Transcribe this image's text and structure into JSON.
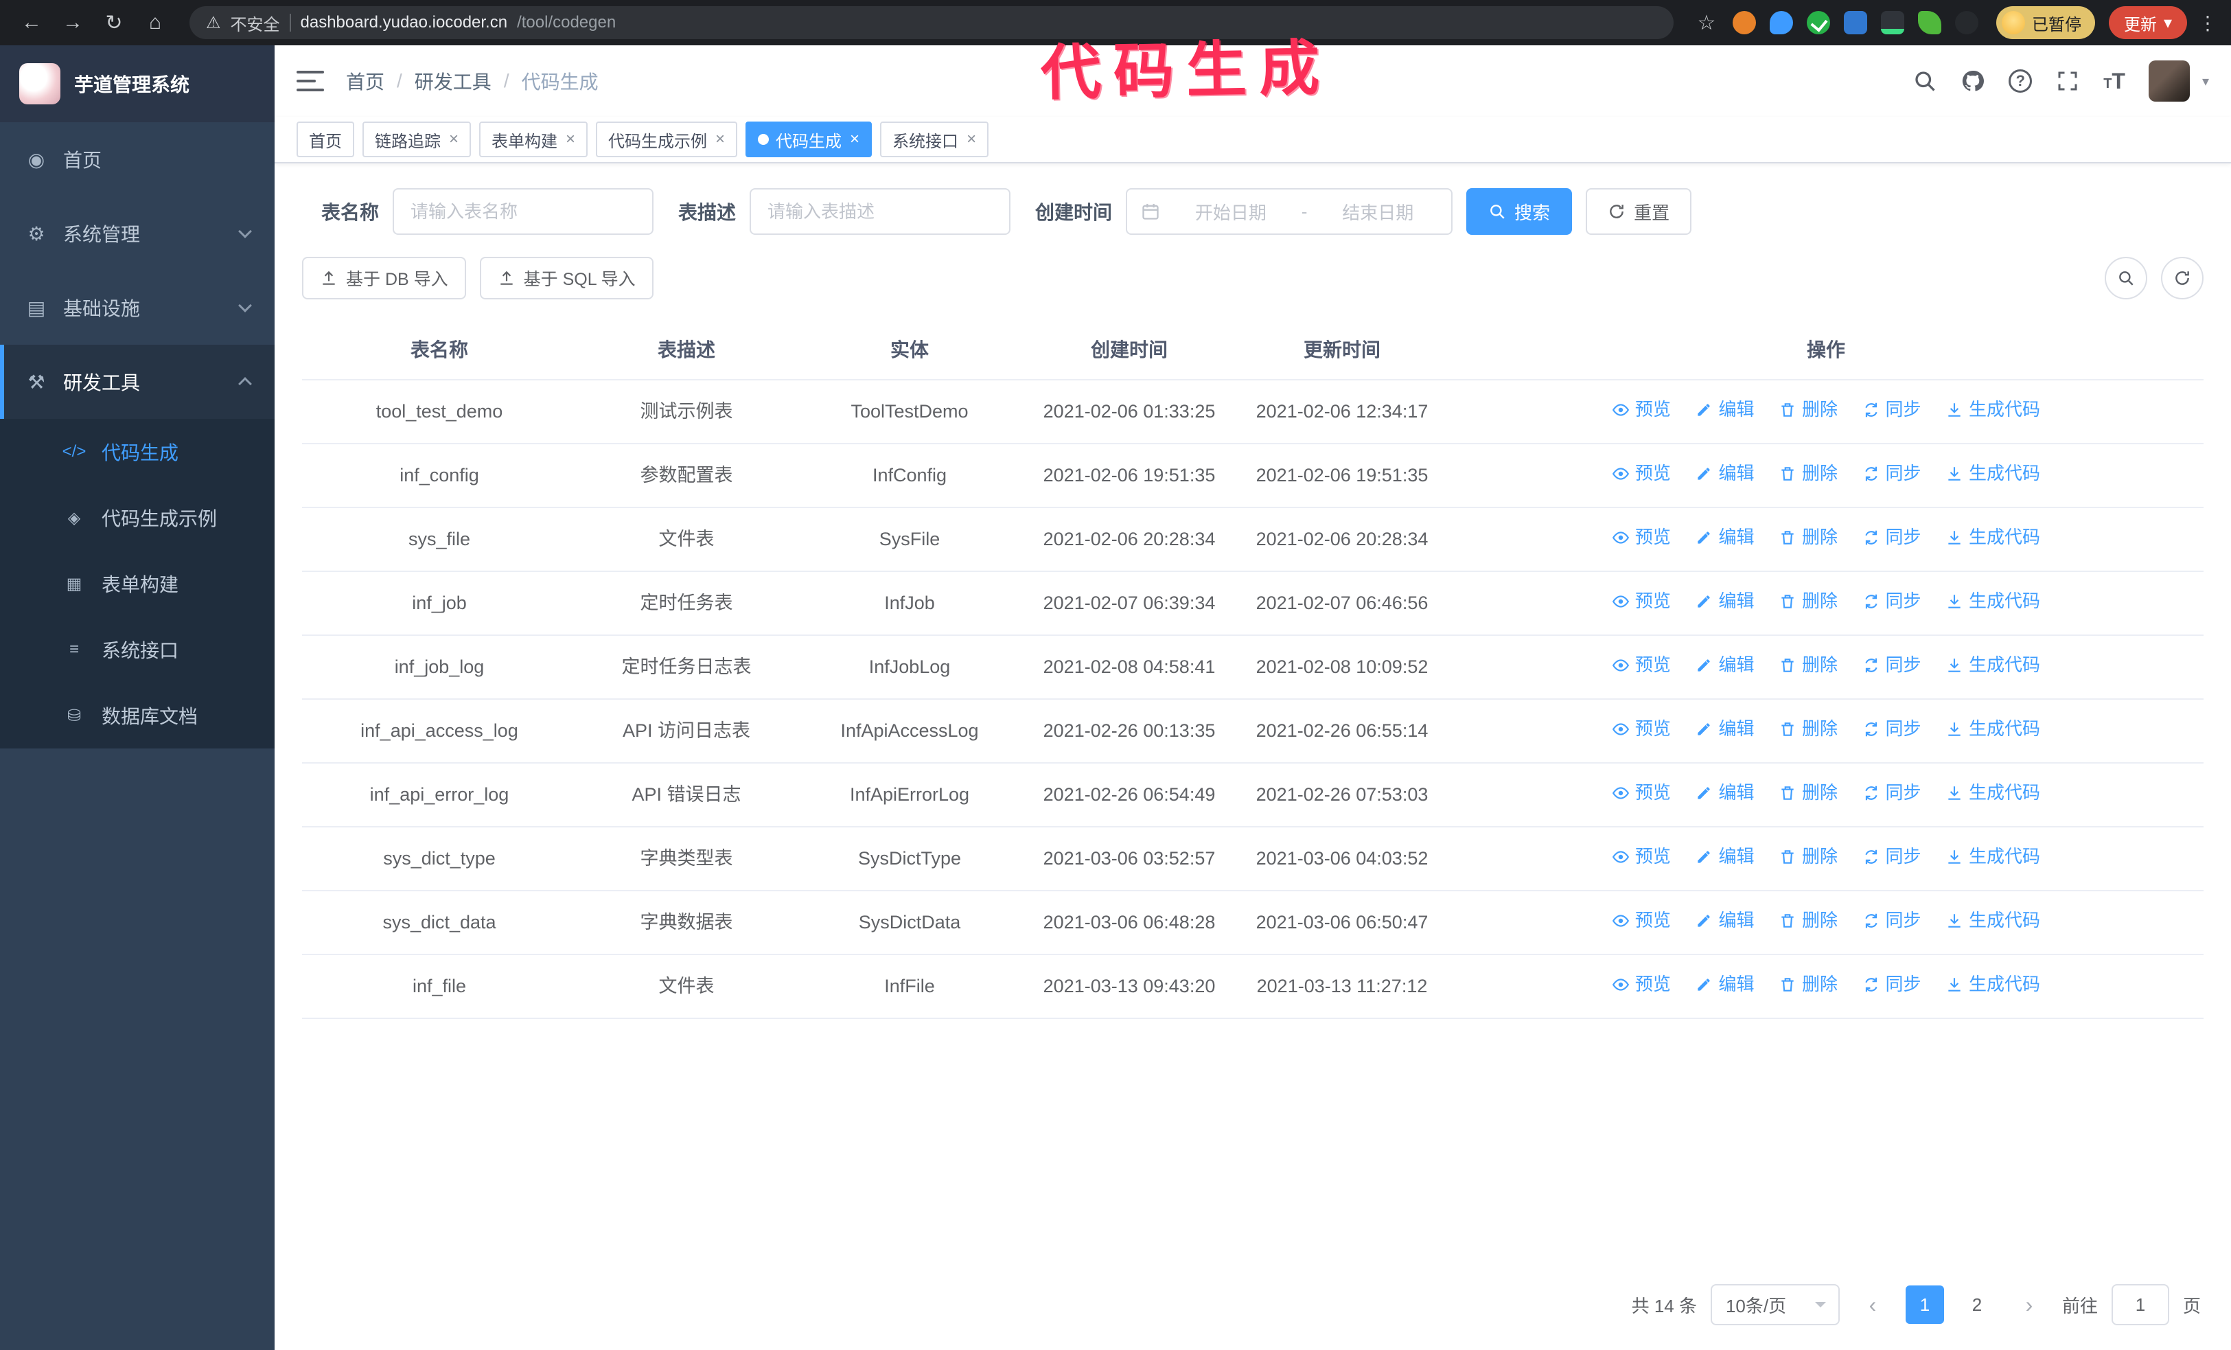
{
  "colors": {
    "accent": "#409eff",
    "sidebar": "#304156",
    "submenu": "#1f2d3d",
    "annotation": "#fb2e57"
  },
  "icons": {
    "back": "←",
    "forward": "→",
    "reload": "↻",
    "home": "⌂",
    "warning": "⚠",
    "star": "☆",
    "kebab": "⋮",
    "close": "×",
    "prev": "‹",
    "next": "›",
    "question": "?",
    "caret_down": "▾",
    "font_size": "T",
    "font_size_small": "T"
  },
  "browser": {
    "security_label": "不安全",
    "url_host": "dashboard.yudao.iocoder.cn",
    "url_path": "/tool/codegen",
    "profile_badge": "已暂停",
    "update_button": "更新"
  },
  "annotation": {
    "text": "代码生成"
  },
  "sidebar": {
    "logo_title": "芋道管理系统",
    "items": [
      {
        "label": "首页",
        "icon": "◉"
      },
      {
        "label": "系统管理",
        "icon": "⚙"
      },
      {
        "label": "基础设施",
        "icon": "▤"
      },
      {
        "label": "研发工具",
        "icon": "⚒"
      }
    ],
    "sub_items": [
      {
        "label": "代码生成",
        "icon": "</>"
      },
      {
        "label": "代码生成示例",
        "icon": "◈"
      },
      {
        "label": "表单构建",
        "icon": "▦"
      },
      {
        "label": "系统接口",
        "icon": "≡"
      },
      {
        "label": "数据库文档",
        "icon": "⛁"
      }
    ]
  },
  "header": {
    "breadcrumb": [
      "首页",
      "研发工具",
      "代码生成"
    ],
    "separator": "/"
  },
  "tabs": [
    {
      "label": "首页"
    },
    {
      "label": "链路追踪"
    },
    {
      "label": "表单构建"
    },
    {
      "label": "代码生成示例"
    },
    {
      "label": "代码生成"
    },
    {
      "label": "系统接口"
    }
  ],
  "filters": {
    "table_name_label": "表名称",
    "table_name_placeholder": "请输入表名称",
    "table_desc_label": "表描述",
    "table_desc_placeholder": "请输入表描述",
    "create_time_label": "创建时间",
    "date_start_placeholder": "开始日期",
    "date_separator": "-",
    "date_end_placeholder": "结束日期",
    "search_button": "搜索",
    "reset_button": "重置"
  },
  "toolbar": {
    "import_db_button": "基于 DB 导入",
    "import_sql_button": "基于 SQL 导入"
  },
  "table": {
    "columns": [
      "表名称",
      "表描述",
      "实体",
      "创建时间",
      "更新时间",
      "操作"
    ],
    "ops": [
      "预览",
      "编辑",
      "删除",
      "同步",
      "生成代码"
    ],
    "rows": [
      {
        "name": "tool_test_demo",
        "desc": "测试示例表",
        "entity": "ToolTestDemo",
        "created": "2021-02-06 01:33:25",
        "updated": "2021-02-06 12:34:17"
      },
      {
        "name": "inf_config",
        "desc": "参数配置表",
        "entity": "InfConfig",
        "created": "2021-02-06 19:51:35",
        "updated": "2021-02-06 19:51:35"
      },
      {
        "name": "sys_file",
        "desc": "文件表",
        "entity": "SysFile",
        "created": "2021-02-06 20:28:34",
        "updated": "2021-02-06 20:28:34"
      },
      {
        "name": "inf_job",
        "desc": "定时任务表",
        "entity": "InfJob",
        "created": "2021-02-07 06:39:34",
        "updated": "2021-02-07 06:46:56"
      },
      {
        "name": "inf_job_log",
        "desc": "定时任务日志表",
        "entity": "InfJobLog",
        "created": "2021-02-08 04:58:41",
        "updated": "2021-02-08 10:09:52"
      },
      {
        "name": "inf_api_access_log",
        "desc": "API 访问日志表",
        "entity": "InfApiAccessLog",
        "created": "2021-02-26 00:13:35",
        "updated": "2021-02-26 06:55:14"
      },
      {
        "name": "inf_api_error_log",
        "desc": "API 错误日志",
        "entity": "InfApiErrorLog",
        "created": "2021-02-26 06:54:49",
        "updated": "2021-02-26 07:53:03"
      },
      {
        "name": "sys_dict_type",
        "desc": "字典类型表",
        "entity": "SysDictType",
        "created": "2021-03-06 03:52:57",
        "updated": "2021-03-06 04:03:52"
      },
      {
        "name": "sys_dict_data",
        "desc": "字典数据表",
        "entity": "SysDictData",
        "created": "2021-03-06 06:48:28",
        "updated": "2021-03-06 06:50:47"
      },
      {
        "name": "inf_file",
        "desc": "文件表",
        "entity": "InfFile",
        "created": "2021-03-13 09:43:20",
        "updated": "2021-03-13 11:27:12"
      }
    ]
  },
  "pagination": {
    "total_text": "共 14 条",
    "page_size": "10条/页",
    "pages": [
      "1",
      "2"
    ],
    "goto_label": "前往",
    "goto_value": "1",
    "goto_unit": "页"
  }
}
